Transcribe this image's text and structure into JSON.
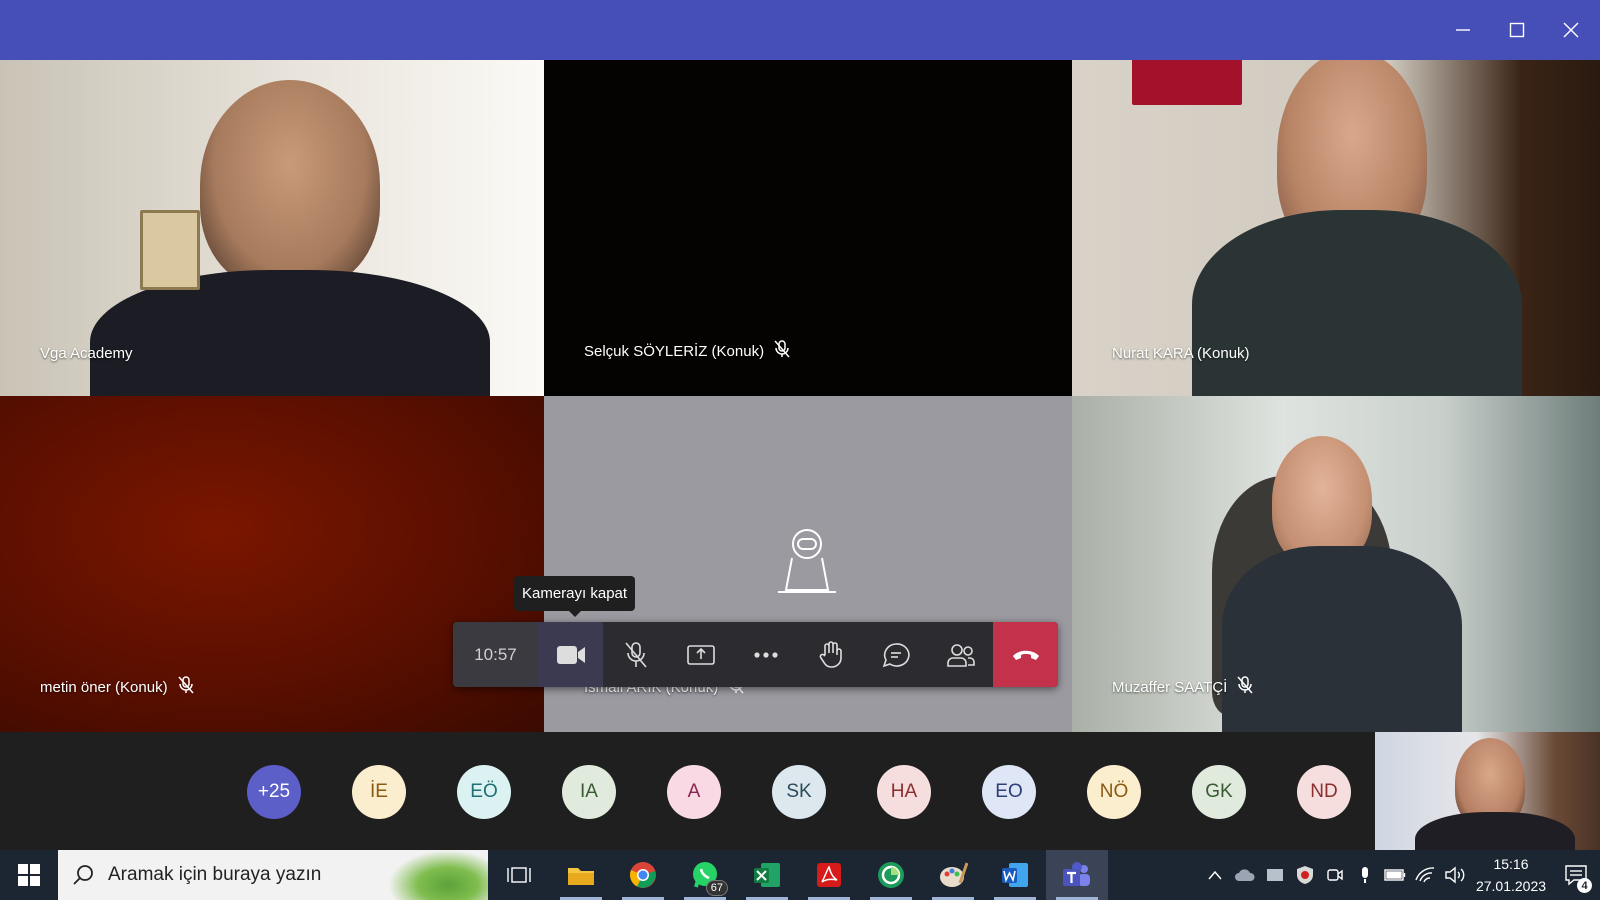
{
  "window": {
    "controls": [
      "minimize",
      "maximize",
      "close"
    ]
  },
  "tiles": [
    {
      "name": "Vga Academy",
      "muted": false
    },
    {
      "name": "Selçuk SÖYLERİZ (Konuk)",
      "muted": true
    },
    {
      "name": "Nurat KARA (Konuk)",
      "muted": false
    },
    {
      "name": "metin öner (Konuk)",
      "muted": true
    },
    {
      "name": "İsmail ARIK (Konuk)",
      "muted": true
    },
    {
      "name": "Muzaffer SAATÇİ",
      "muted": true
    }
  ],
  "controls": {
    "timer": "10:57",
    "tooltip": "Kamerayı kapat",
    "buttons": [
      "camera-icon",
      "mic-off-icon",
      "share-screen-icon",
      "more-icon",
      "raise-hand-icon",
      "chat-icon",
      "participants-icon",
      "hang-up-icon"
    ]
  },
  "participants": [
    {
      "initials": "+25",
      "bg": "#5b5fc7",
      "fg": "#ffffff"
    },
    {
      "initials": "İE",
      "bg": "#fbeecf",
      "fg": "#8a5a12"
    },
    {
      "initials": "EÖ",
      "bg": "#dcf2f2",
      "fg": "#1f6f75"
    },
    {
      "initials": "IA",
      "bg": "#e0ebdd",
      "fg": "#3a5a33"
    },
    {
      "initials": "A",
      "bg": "#f8d9e4",
      "fg": "#8b2550"
    },
    {
      "initials": "SK",
      "bg": "#dde8ee",
      "fg": "#2c4a5c"
    },
    {
      "initials": "HA",
      "bg": "#f6dede",
      "fg": "#8b2e2e"
    },
    {
      "initials": "EO",
      "bg": "#dfe6f6",
      "fg": "#2c3f77"
    },
    {
      "initials": "NÖ",
      "bg": "#fbeecf",
      "fg": "#8a5a12"
    },
    {
      "initials": "GK",
      "bg": "#e0ebdd",
      "fg": "#3a5a33"
    },
    {
      "initials": "ND",
      "bg": "#f6dede",
      "fg": "#8b2e2e"
    }
  ],
  "taskbar": {
    "search_placeholder": "Aramak için buraya yazın",
    "whatsapp_badge": "67",
    "time": "15:16",
    "date": "27.01.2023",
    "notification_count": "4"
  }
}
